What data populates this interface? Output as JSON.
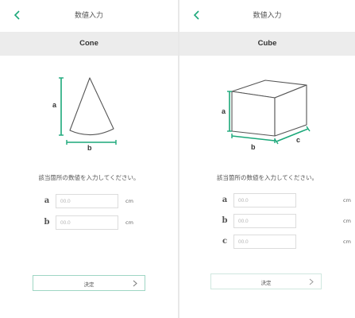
{
  "accent_color": "#1ca87a",
  "screens": [
    {
      "header": {
        "title": "数値入力",
        "back_icon": "chevron-left-icon"
      },
      "shape_name": "Cone",
      "diagram_labels": {
        "a": "a",
        "b": "b"
      },
      "instruction": "該当箇所の数値を入力してください。",
      "fields": [
        {
          "label": "a",
          "placeholder": "00.0",
          "unit": "cm"
        },
        {
          "label": "b",
          "placeholder": "00.0",
          "unit": "cm"
        }
      ],
      "submit": {
        "label": "決定",
        "icon": "chevron-right-icon"
      }
    },
    {
      "header": {
        "title": "数値入力",
        "back_icon": "chevron-left-icon"
      },
      "shape_name": "Cube",
      "diagram_labels": {
        "a": "a",
        "b": "b",
        "c": "c"
      },
      "instruction": "該当箇所の数値を入力してください。",
      "fields": [
        {
          "label": "a",
          "placeholder": "00.0",
          "unit": "cm"
        },
        {
          "label": "b",
          "placeholder": "00.0",
          "unit": "cm"
        },
        {
          "label": "c",
          "placeholder": "00.0",
          "unit": "cm"
        }
      ],
      "submit": {
        "label": "決定",
        "icon": "chevron-right-icon"
      }
    }
  ]
}
